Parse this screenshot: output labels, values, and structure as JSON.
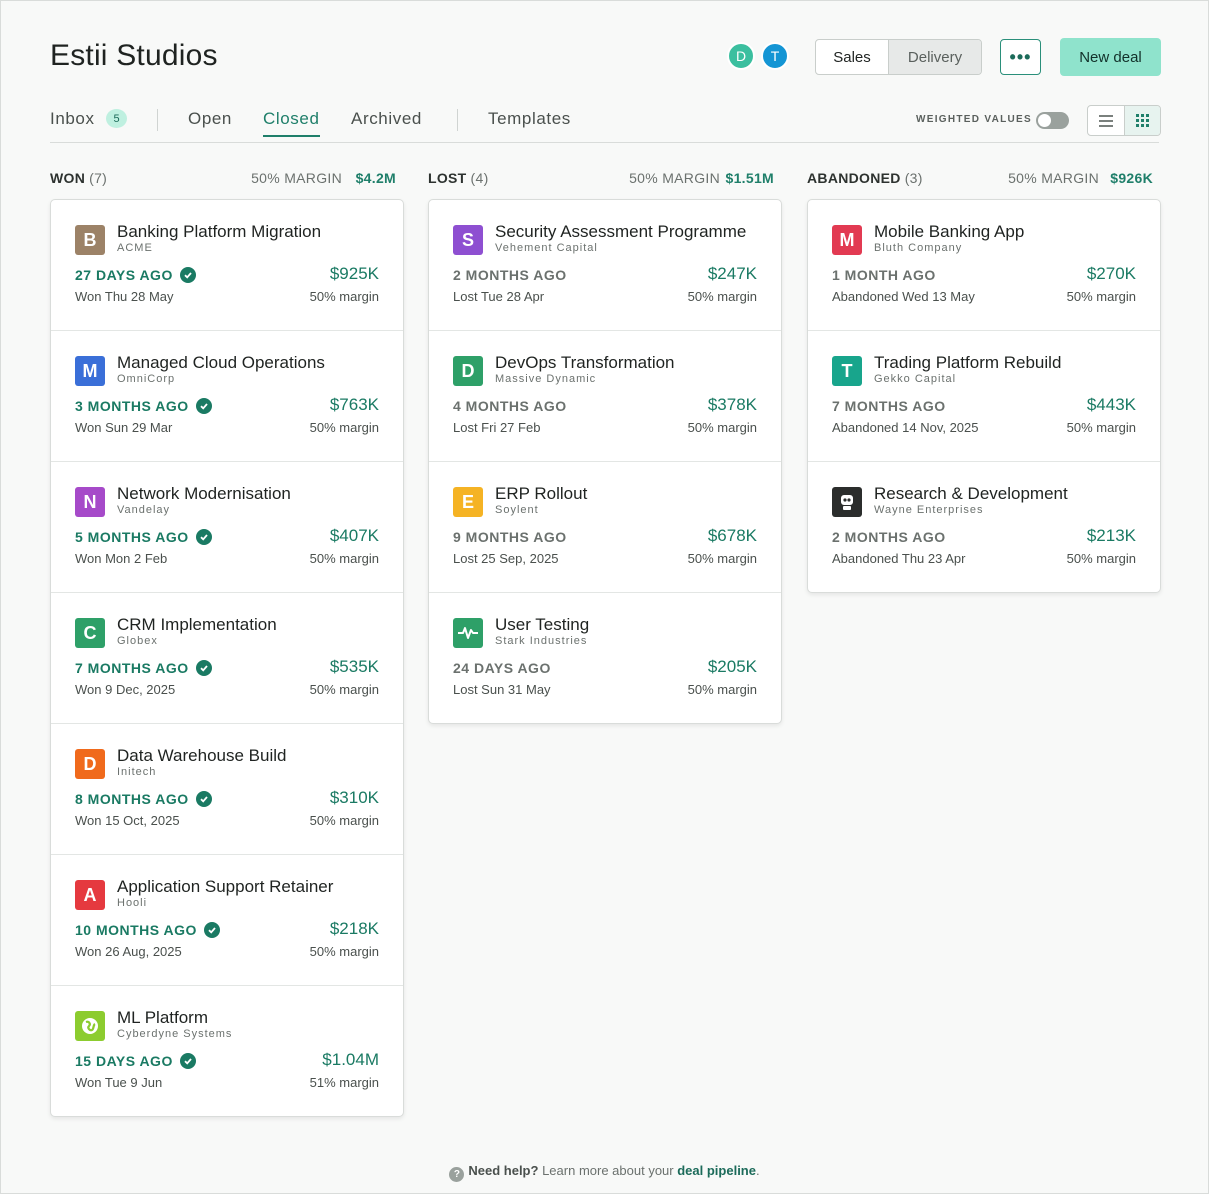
{
  "header": {
    "title": "Estii Studios",
    "avatars": [
      {
        "initial": "D",
        "color": "#3bbf9f"
      },
      {
        "initial": "T",
        "color": "#1495d4"
      }
    ],
    "segment": {
      "options": [
        "Sales",
        "Delivery"
      ],
      "selected": "Delivery"
    },
    "more_label": "•••",
    "new_deal_label": "New deal"
  },
  "tabs": {
    "inbox": {
      "label": "Inbox",
      "badge": "5"
    },
    "open": "Open",
    "closed": "Closed",
    "archived": "Archived",
    "templates": "Templates",
    "active": "Closed"
  },
  "controls": {
    "weighted_values_label": "WEIGHTED VALUES",
    "weighted_values_on": false,
    "view_selected": "grid"
  },
  "columns": [
    {
      "name": "WON",
      "count": "(7)",
      "margin": "50% MARGIN",
      "total": "$4.2M",
      "status": "won",
      "deals": [
        {
          "name": "Banking Platform Migration",
          "client": "ACME",
          "initial": "B",
          "color": "#9c8267",
          "ago": "27 DAYS AGO",
          "when": "Won Thu 28 May",
          "amount": "$925K",
          "margin": "50% margin"
        },
        {
          "name": "Managed Cloud Operations",
          "client": "OmniCorp",
          "initial": "M",
          "color": "#3a6fd8",
          "ago": "3 MONTHS AGO",
          "when": "Won Sun 29 Mar",
          "amount": "$763K",
          "margin": "50% margin"
        },
        {
          "name": "Network Modernisation",
          "client": "Vandelay",
          "initial": "N",
          "color": "#a64ac9",
          "ago": "5 MONTHS AGO",
          "when": "Won Mon 2 Feb",
          "amount": "$407K",
          "margin": "50% margin"
        },
        {
          "name": "CRM Implementation",
          "client": "Globex",
          "initial": "C",
          "color": "#2ea068",
          "ago": "7 MONTHS AGO",
          "when": "Won 9 Dec, 2025",
          "amount": "$535K",
          "margin": "50% margin"
        },
        {
          "name": "Data Warehouse Build",
          "client": "Initech",
          "initial": "D",
          "color": "#f06a1c",
          "ago": "8 MONTHS AGO",
          "when": "Won 15 Oct, 2025",
          "amount": "$310K",
          "margin": "50% margin"
        },
        {
          "name": "Application Support Retainer",
          "client": "Hooli",
          "initial": "A",
          "color": "#e5393f",
          "ago": "10 MONTHS AGO",
          "when": "Won 26 Aug, 2025",
          "amount": "$218K",
          "margin": "50% margin"
        },
        {
          "name": "ML Platform",
          "client": "Cyberdyne Systems",
          "initial": "",
          "icon": "globe-icon",
          "color": "#8ccc2f",
          "ago": "15 DAYS AGO",
          "when": "Won Tue 9 Jun",
          "amount": "$1.04M",
          "margin": "51% margin"
        }
      ]
    },
    {
      "name": "LOST",
      "count": "(4)",
      "margin": "50% MARGIN",
      "total": "$1.51M",
      "status": "lost",
      "deals": [
        {
          "name": "Security Assessment Programme",
          "client": "Vehement Capital",
          "initial": "S",
          "color": "#8e4fd1",
          "ago": "2 MONTHS AGO",
          "when": "Lost Tue 28 Apr",
          "amount": "$247K",
          "margin": "50% margin"
        },
        {
          "name": "DevOps Transformation",
          "client": "Massive Dynamic",
          "initial": "D",
          "color": "#2ea068",
          "ago": "4 MONTHS AGO",
          "when": "Lost Fri 27 Feb",
          "amount": "$378K",
          "margin": "50% margin"
        },
        {
          "name": "ERP Rollout",
          "client": "Soylent",
          "initial": "E",
          "color": "#f5b324",
          "ago": "9 MONTHS AGO",
          "when": "Lost 25 Sep, 2025",
          "amount": "$678K",
          "margin": "50% margin"
        },
        {
          "name": "User Testing",
          "client": "Stark Industries",
          "initial": "",
          "icon": "pulse-icon",
          "color": "#2ea068",
          "ago": "24 DAYS AGO",
          "when": "Lost Sun 31 May",
          "amount": "$205K",
          "margin": "50% margin"
        }
      ]
    },
    {
      "name": "ABANDONED",
      "count": "(3)",
      "margin": "50% MARGIN",
      "total": "$926K",
      "status": "abandoned",
      "deals": [
        {
          "name": "Mobile Banking App",
          "client": "Bluth Company",
          "initial": "M",
          "color": "#e23a52",
          "ago": "1 MONTH AGO",
          "when": "Abandoned Wed 13 May",
          "amount": "$270K",
          "margin": "50% margin"
        },
        {
          "name": "Trading Platform Rebuild",
          "client": "Gekko Capital",
          "initial": "T",
          "color": "#18a58c",
          "ago": "7 MONTHS AGO",
          "when": "Abandoned 14 Nov, 2025",
          "amount": "$443K",
          "margin": "50% margin"
        },
        {
          "name": "Research & Development",
          "client": "Wayne Enterprises",
          "initial": "",
          "icon": "robot-icon",
          "color": "#2b2d2c",
          "ago": "2 MONTHS AGO",
          "when": "Abandoned Thu 23 Apr",
          "amount": "$213K",
          "margin": "50% margin"
        }
      ]
    }
  ],
  "footer": {
    "need_help": "Need help?",
    "text": "Learn more about your",
    "link": "deal pipeline",
    "end": "."
  }
}
